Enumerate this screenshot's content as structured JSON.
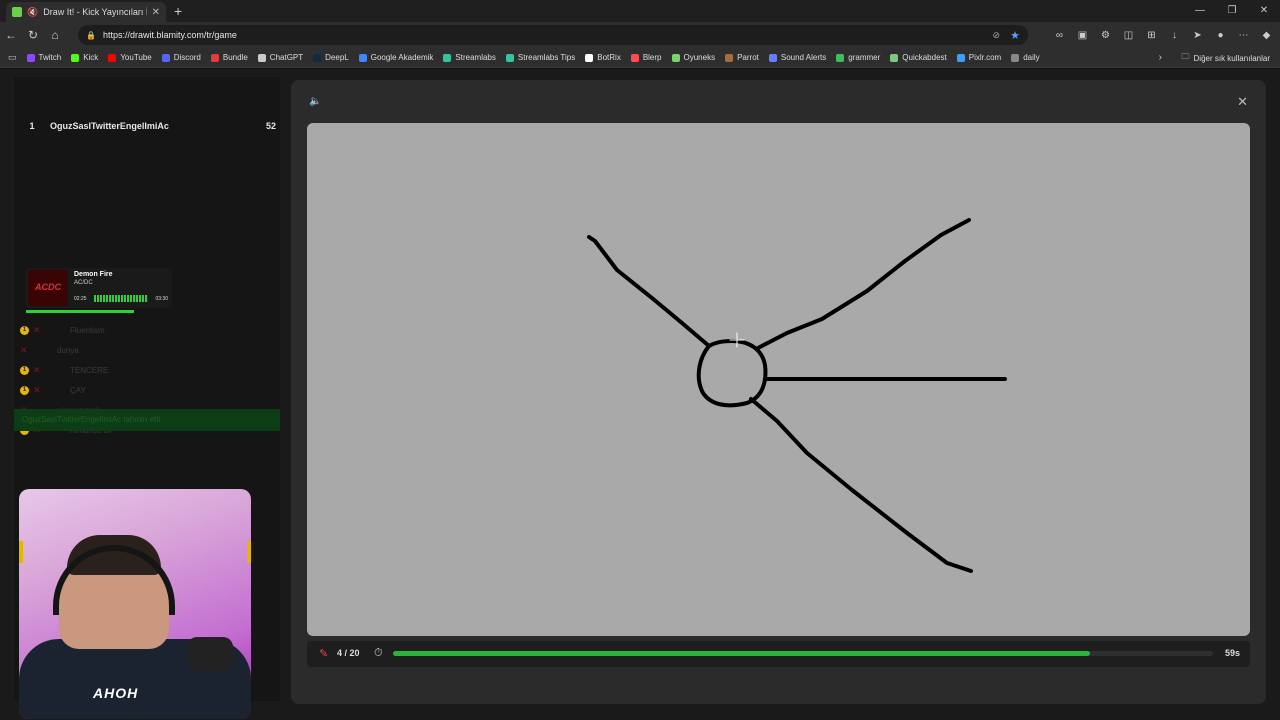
{
  "browser": {
    "tab_title": "Draw It! - Kick Yayıncıları İçin",
    "url": "https://drawit.blamity.com/tr/game",
    "bookmarks": [
      {
        "label": "Twitch",
        "color": "#9146ff"
      },
      {
        "label": "Kick",
        "color": "#53fc18"
      },
      {
        "label": "YouTube",
        "color": "#ff0000"
      },
      {
        "label": "Discord",
        "color": "#5865f2"
      },
      {
        "label": "Bundle",
        "color": "#e23b3b"
      },
      {
        "label": "ChatGPT",
        "color": "#cccccc"
      },
      {
        "label": "DeepL",
        "color": "#0f2b46"
      },
      {
        "label": "Google Akademik",
        "color": "#4285f4"
      },
      {
        "label": "Streamlabs",
        "color": "#31c3a2"
      },
      {
        "label": "Streamlabs Tips",
        "color": "#31c3a2"
      },
      {
        "label": "BotRix",
        "color": "#ffffff"
      },
      {
        "label": "Blerp",
        "color": "#ff4a55"
      },
      {
        "label": "Oyuneks",
        "color": "#7bd36b"
      },
      {
        "label": "Parrot",
        "color": "#a0703a"
      },
      {
        "label": "Sound Alerts",
        "color": "#6b7bff"
      },
      {
        "label": "grammer",
        "color": "#3bbf5a"
      },
      {
        "label": "Quickabdest",
        "color": "#7fc87f"
      },
      {
        "label": "Pixlr.com",
        "color": "#3aa0ff"
      },
      {
        "label": "daily",
        "color": "#888888"
      }
    ],
    "other_bookmarks": "Diğer sık kullanılanlar"
  },
  "leaderboard": [
    {
      "rank": "1",
      "name": "OguzSasITwitterEngelImiAc",
      "points": "52"
    }
  ],
  "now_playing": {
    "art_text": "ACDC",
    "song": "Demon Fire",
    "artist": "AC/DC",
    "elapsed": "02:25",
    "duration": "03:30",
    "progress": 0.74
  },
  "guesses": [
    {
      "name": "Fluentism",
      "coin": true
    },
    {
      "name": "dunya",
      "coin": false
    },
    {
      "name": "TENCERE",
      "coin": true
    },
    {
      "name": "ÇAY",
      "coin": true
    },
    {
      "name": "pinguinstrak",
      "coin": false
    },
    {
      "name": "Almanca bir",
      "coin": true
    }
  ],
  "guess_highlight": "OguzSasITwitterEngelImiAc tahmin etti",
  "webcam": {
    "shirt_text": "AHOH"
  },
  "game": {
    "round": "4 / 20",
    "timer_progress": 0.85,
    "seconds": "59s"
  },
  "colors": {
    "accent_green": "#2bb43c",
    "canvas_bg": "#a9a9a9",
    "pencil_red": "#e84545"
  }
}
